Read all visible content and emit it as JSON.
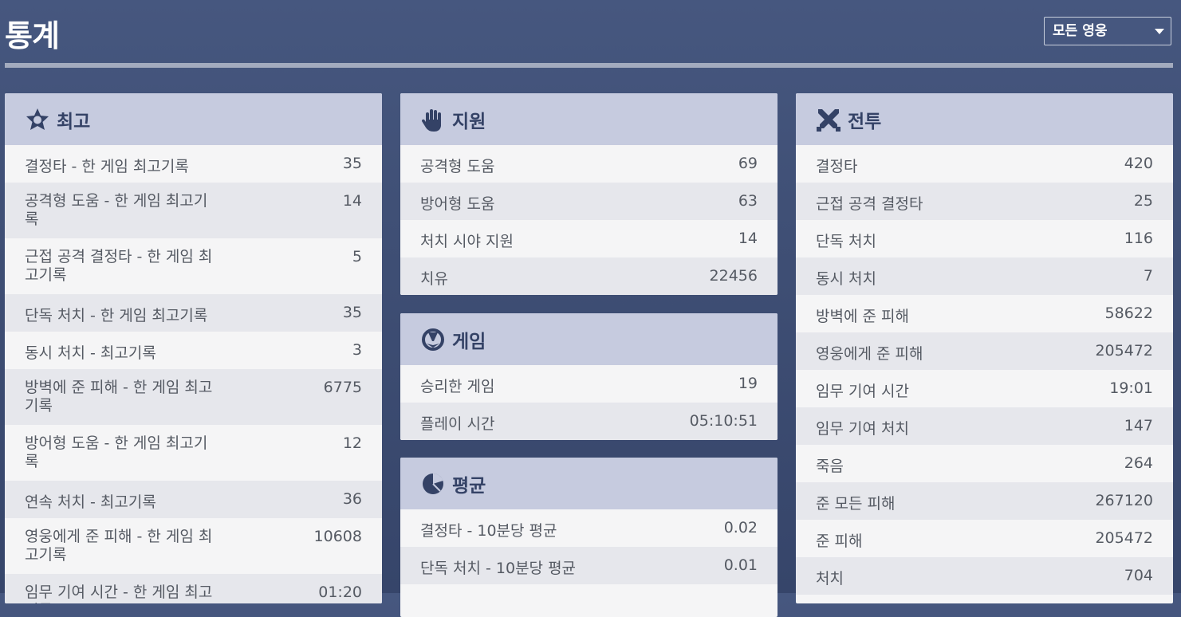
{
  "page": {
    "title": "통계"
  },
  "hero_select": {
    "value": "모든 영웅"
  },
  "panels": {
    "best": {
      "title": "최고",
      "icon": "star-badge-icon",
      "rows": [
        {
          "label": "결정타 - 한 게임 최고기록",
          "value": "35"
        },
        {
          "label": "공격형 도움 - 한 게임 최고기록",
          "value": "14"
        },
        {
          "label": "근접 공격 결정타 - 한 게임 최고기록",
          "value": "5"
        },
        {
          "label": "단독 처치 - 한 게임 최고기록",
          "value": "35"
        },
        {
          "label": "동시 처치 - 최고기록",
          "value": "3"
        },
        {
          "label": "방벽에 준 피해 - 한 게임 최고기록",
          "value": "6775"
        },
        {
          "label": "방어형 도움 - 한 게임 최고기록",
          "value": "12"
        },
        {
          "label": "연속 처치 - 최고기록",
          "value": "36"
        },
        {
          "label": "영웅에게 준 피해 - 한 게임 최고기록",
          "value": "10608"
        },
        {
          "label": "임무 기여 시간 - 한 게임 최고기록",
          "value": "01:20"
        }
      ]
    },
    "assist": {
      "title": "지원",
      "icon": "hand-icon",
      "rows": [
        {
          "label": "공격형 도움",
          "value": "69"
        },
        {
          "label": "방어형 도움",
          "value": "63"
        },
        {
          "label": "처치 시야 지원",
          "value": "14"
        },
        {
          "label": "치유",
          "value": "22456"
        }
      ]
    },
    "game": {
      "title": "게임",
      "icon": "overwatch-logo-icon",
      "rows": [
        {
          "label": "승리한 게임",
          "value": "19"
        },
        {
          "label": "플레이 시간",
          "value": "05:10:51"
        }
      ]
    },
    "average": {
      "title": "평균",
      "icon": "pie-chart-icon",
      "rows": [
        {
          "label": "결정타 - 10분당 평균",
          "value": "0.02"
        },
        {
          "label": "단독 처치 - 10분당 평균",
          "value": "0.01"
        }
      ]
    },
    "combat": {
      "title": "전투",
      "icon": "crossed-swords-icon",
      "rows": [
        {
          "label": "결정타",
          "value": "420"
        },
        {
          "label": "근접 공격 결정타",
          "value": "25"
        },
        {
          "label": "단독 처치",
          "value": "116"
        },
        {
          "label": "동시 처치",
          "value": "7"
        },
        {
          "label": "방벽에 준 피해",
          "value": "58622"
        },
        {
          "label": "영웅에게 준 피해",
          "value": "205472"
        },
        {
          "label": "임무 기여 시간",
          "value": "19:01"
        },
        {
          "label": "임무 기여 처치",
          "value": "147"
        },
        {
          "label": "죽음",
          "value": "264"
        },
        {
          "label": "준 모든 피해",
          "value": "267120"
        },
        {
          "label": "준 피해",
          "value": "205472"
        },
        {
          "label": "처치",
          "value": "704"
        }
      ]
    }
  }
}
